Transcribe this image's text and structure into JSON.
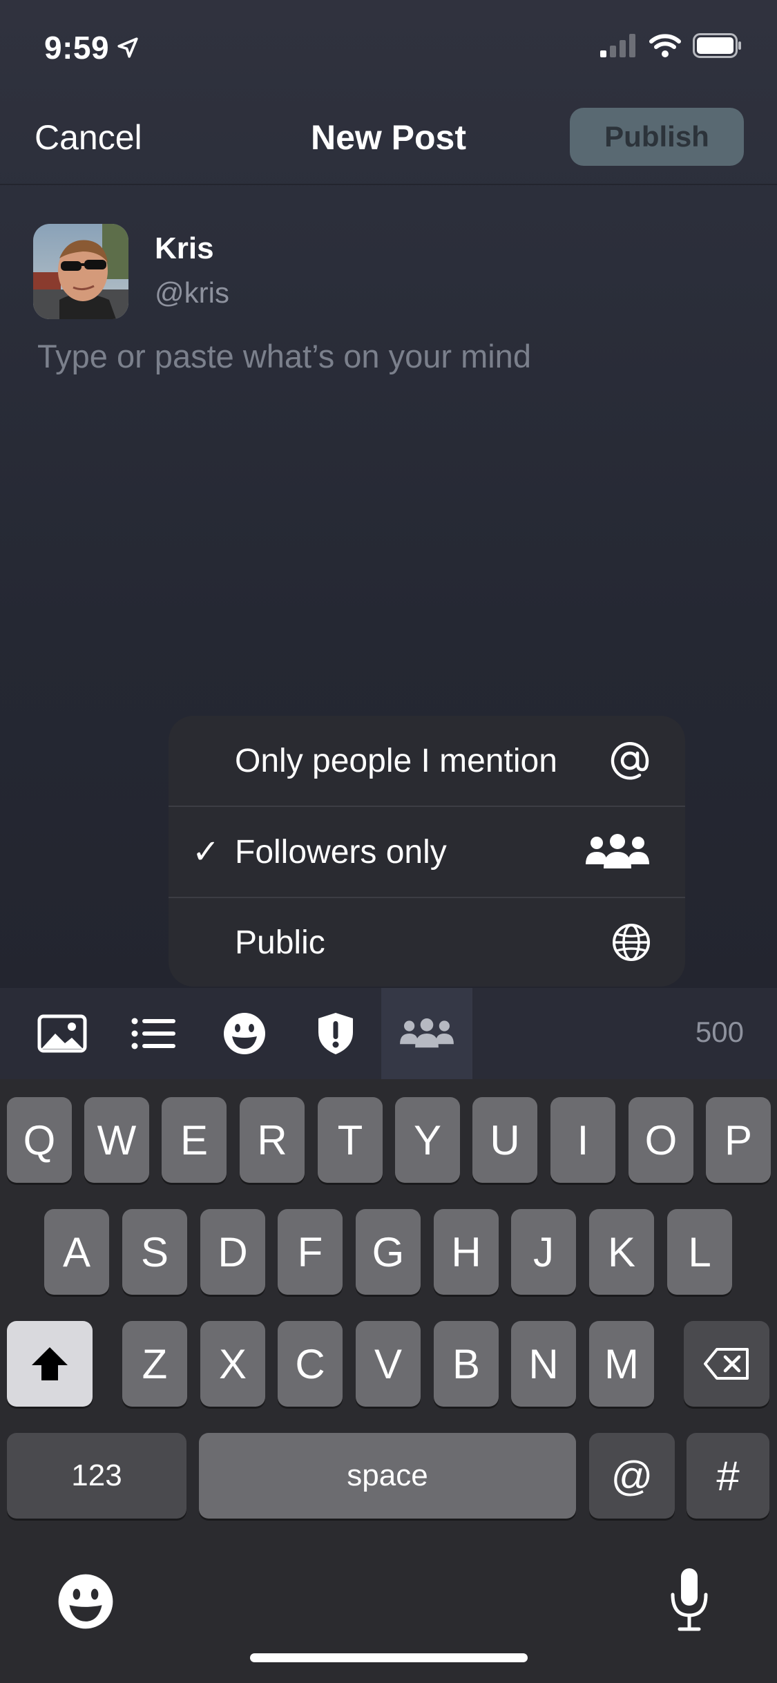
{
  "status": {
    "time": "9:59"
  },
  "header": {
    "cancel_label": "Cancel",
    "title": "New Post",
    "publish_label": "Publish"
  },
  "user": {
    "name": "Kris",
    "handle": "@kris"
  },
  "compose": {
    "placeholder": "Type or paste what’s on your mind"
  },
  "visibility_menu": {
    "items": [
      {
        "label": "Only people I mention",
        "icon": "at-icon",
        "checked": false
      },
      {
        "label": "Followers only",
        "icon": "people-icon",
        "checked": true
      },
      {
        "label": "Public",
        "icon": "globe-icon",
        "checked": false
      }
    ],
    "check_mark": "✓"
  },
  "toolbar": {
    "icons": [
      "image-icon",
      "list-icon",
      "emoji-icon",
      "content-warning-icon",
      "visibility-icon"
    ],
    "char_count": "500"
  },
  "keyboard": {
    "row1": [
      "Q",
      "W",
      "E",
      "R",
      "T",
      "Y",
      "U",
      "I",
      "O",
      "P"
    ],
    "row2": [
      "A",
      "S",
      "D",
      "F",
      "G",
      "H",
      "J",
      "K",
      "L"
    ],
    "row3": [
      "Z",
      "X",
      "C",
      "V",
      "B",
      "N",
      "M"
    ],
    "numbers_label": "123",
    "space_label": "space",
    "at_label": "@",
    "hash_label": "#"
  },
  "colors": {
    "accent_publish": "#596972",
    "background": "#2c2f3b",
    "menu_bg": "#2a2b31"
  }
}
